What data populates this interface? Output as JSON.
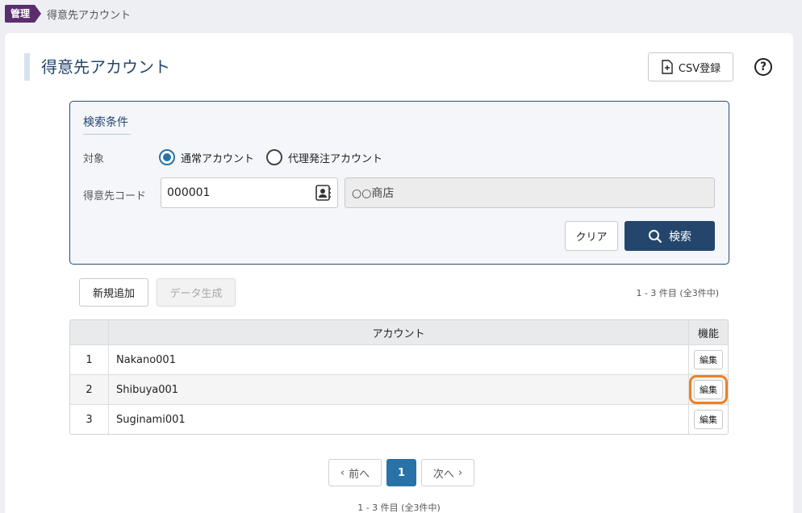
{
  "breadcrumb": {
    "tag": "管理",
    "current": "得意先アカウント"
  },
  "page": {
    "title": "得意先アカウント",
    "csv_label": "CSV登録",
    "help": "?"
  },
  "search": {
    "title": "検索条件",
    "target_label": "対象",
    "radio_normal": "通常アカウント",
    "radio_proxy": "代理発注アカウント",
    "selected": "通常アカウント",
    "code_label": "得意先コード",
    "code_value": "000001",
    "name_value": "○○商店",
    "clear_label": "クリア",
    "search_label": "検索"
  },
  "actions": {
    "new_label": "新規追加",
    "generate_label": "データ生成",
    "count_text": "1 - 3 件目 (全3件中)"
  },
  "table": {
    "headers": {
      "account": "アカウント",
      "function": "機能"
    },
    "rows": [
      {
        "num": "1",
        "account": "Nakano001",
        "edit": "編集"
      },
      {
        "num": "2",
        "account": "Shibuya001",
        "edit": "編集"
      },
      {
        "num": "3",
        "account": "Suginami001",
        "edit": "編集"
      }
    ]
  },
  "pagination": {
    "prev": "前へ",
    "current": "1",
    "next": "次へ",
    "count_text": "1 - 3 件目 (全3件中)"
  },
  "colors": {
    "accent": "#24466d",
    "tag": "#5c2d6e",
    "page_active": "#2872a8",
    "highlight": "#f07f22"
  }
}
